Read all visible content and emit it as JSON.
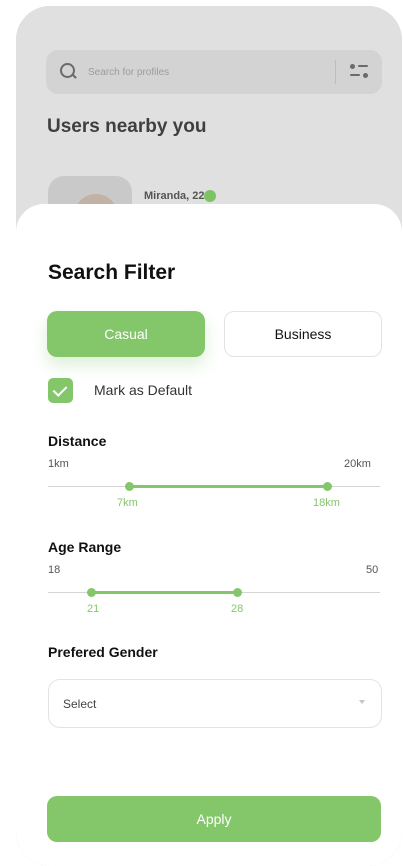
{
  "background": {
    "search_placeholder": "Search for profiles",
    "title": "Users nearby you",
    "user": {
      "name": "Miranda, 22"
    }
  },
  "filter": {
    "title": "Search Filter",
    "segments": [
      {
        "label": "Casual",
        "selected": true
      },
      {
        "label": "Business",
        "selected": false
      }
    ],
    "default_checkbox": {
      "label": "Mark as Default",
      "checked": true
    },
    "distance": {
      "title": "Distance",
      "min_label": "1km",
      "max_label": "20km",
      "low_label": "7km",
      "high_label": "18km",
      "low_value": 7,
      "high_value": 18
    },
    "age_range": {
      "title": "Age Range",
      "min_label": "18",
      "max_label": "50",
      "low_label": "21",
      "high_label": "28",
      "low_value": 21,
      "high_value": 28
    },
    "gender": {
      "title": "Prefered Gender",
      "select_value": "Select"
    },
    "apply_label": "Apply"
  },
  "colors": {
    "accent": "#84c76a",
    "backdrop": "#dcdcdc"
  }
}
